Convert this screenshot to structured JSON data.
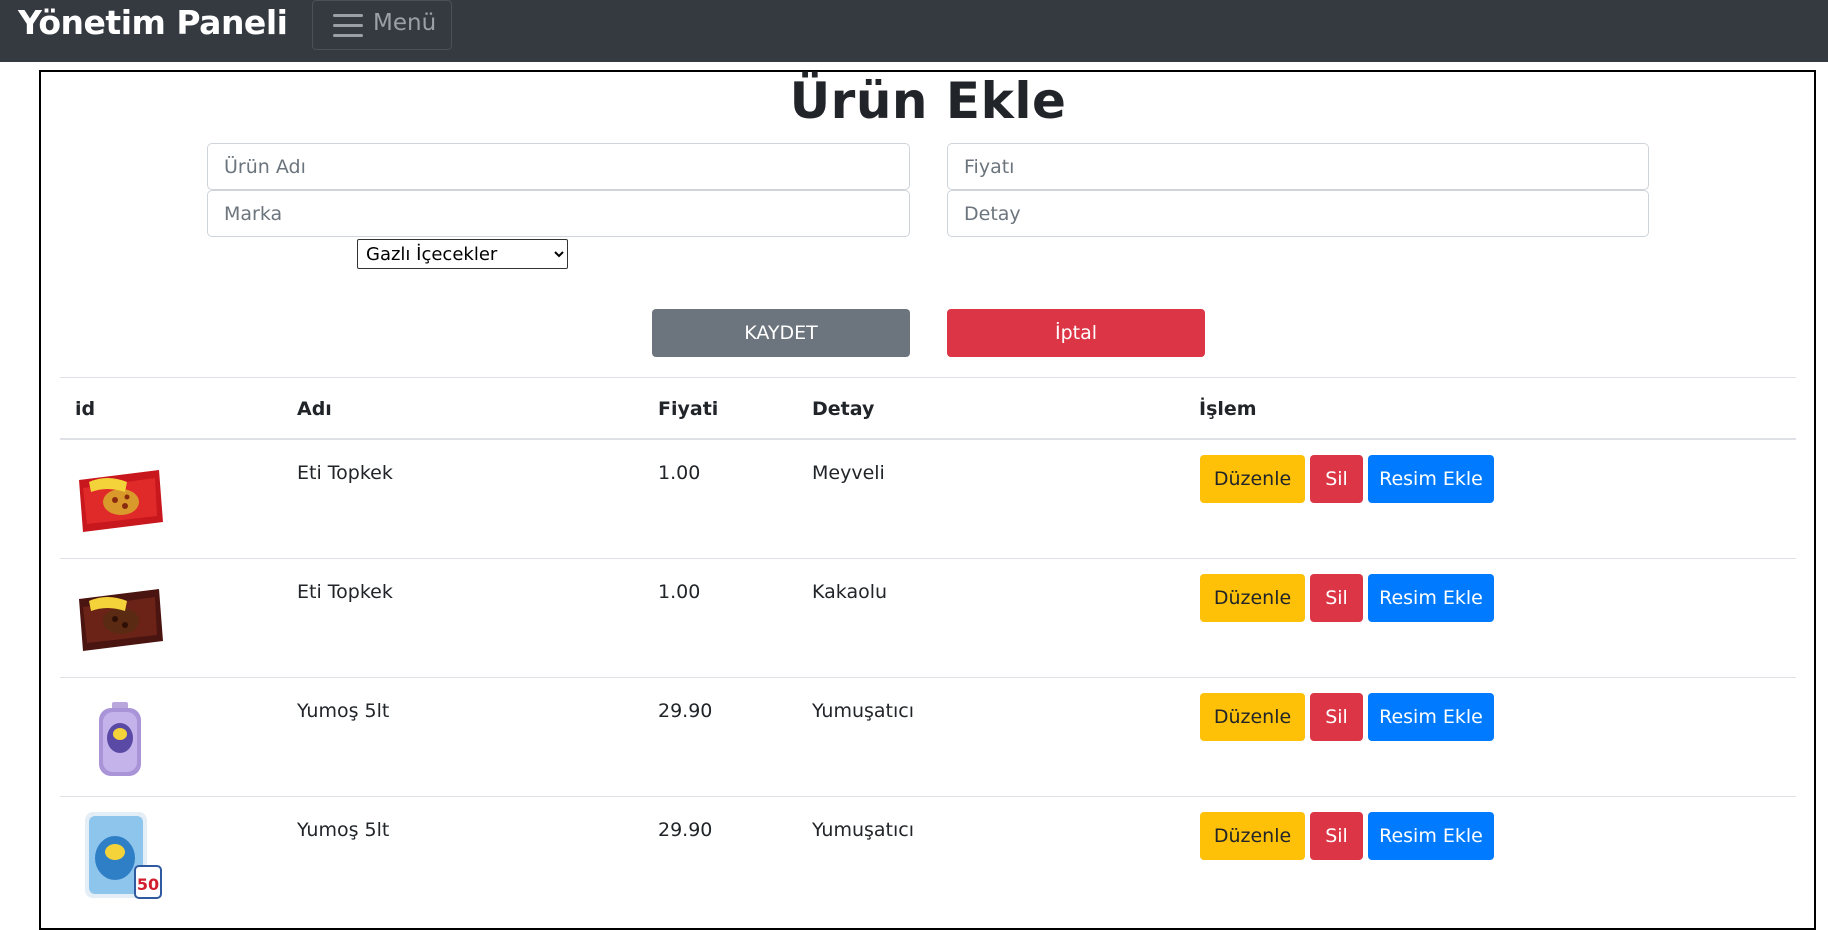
{
  "navbar": {
    "brand": "Yönetim Paneli",
    "menu_label": "Menü"
  },
  "form": {
    "title": "Ürün Ekle",
    "name_placeholder": "Ürün Adı",
    "price_placeholder": "Fiyatı",
    "brand_placeholder": "Marka",
    "detail_placeholder": "Detay",
    "category_selected": "Gazlı İçecekler",
    "save_label": "KAYDET",
    "cancel_label": "İptal"
  },
  "table": {
    "headers": {
      "id": "id",
      "name": "Adı",
      "price": "Fiyati",
      "detail": "Detay",
      "actions": "İşlem"
    },
    "rows": [
      {
        "image": "topkek-fruit-image",
        "name": "Eti Topkek",
        "price": "1.00",
        "detail": "Meyveli"
      },
      {
        "image": "topkek-cocoa-image",
        "name": "Eti Topkek",
        "price": "1.00",
        "detail": "Kakaolu"
      },
      {
        "image": "yumos-purple-bottle-image",
        "name": "Yumoş 5lt",
        "price": "29.90",
        "detail": "Yumuşatıcı"
      },
      {
        "image": "yumos-blue-bottle-image",
        "name": "Yumoş 5lt",
        "price": "29.90",
        "detail": "Yumuşatıcı"
      }
    ],
    "edit_label": "Düzenle",
    "delete_label": "Sil",
    "add_image_label": "Resim Ekle",
    "badge_text": "50"
  },
  "colors": {
    "navbar_bg": "#343a40",
    "secondary": "#6c757d",
    "danger": "#dc3545",
    "warning": "#ffc107",
    "primary": "#007bff"
  }
}
